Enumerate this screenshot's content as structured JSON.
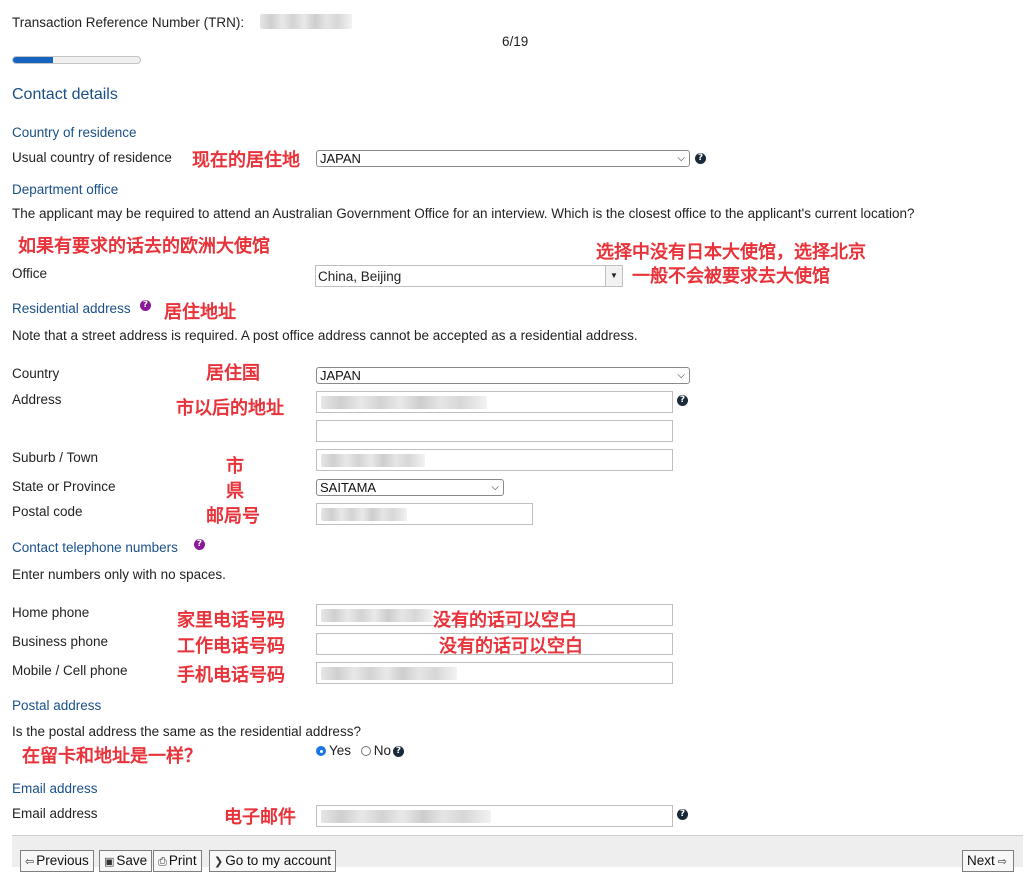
{
  "header": {
    "trn_label": "Transaction Reference Number (TRN):",
    "page_counter": "6/19",
    "progress_fraction": 0.3158
  },
  "contact_details": {
    "title": "Contact details"
  },
  "country_of_residence": {
    "section": "Country of residence",
    "label": "Usual country of residence",
    "value": "JAPAN",
    "annotation": "现在的居住地"
  },
  "department_office": {
    "section": "Department office",
    "description": "The applicant may be required to attend an Australian Government Office for an interview. Which is the closest office to the applicant's current location?",
    "annotation_1": "如果有要求的话去的欧洲大使馆",
    "annotation_2_line1": "选择中没有日本大使馆，选择北京",
    "annotation_2_line2": "一般不会被要求去大使馆",
    "office_label": "Office",
    "office_value": "China, Beijing"
  },
  "residential_address": {
    "section": "Residential address",
    "annotation": "居住地址",
    "note": "Note that a street address is required. A post office address cannot be accepted as a residential address.",
    "country_label": "Country",
    "country_value": "JAPAN",
    "country_annotation": "居住国",
    "address_label": "Address",
    "address_annotation": "市以后的地址",
    "suburb_label": "Suburb / Town",
    "suburb_annotation": "市",
    "state_label": "State or Province",
    "state_value": "SAITAMA",
    "state_annotation": "県",
    "postal_label": "Postal code",
    "postal_annotation": "邮局号"
  },
  "contact_phone": {
    "section": "Contact telephone numbers",
    "note": "Enter numbers only with no spaces.",
    "home_label": "Home phone",
    "home_annotation": "家里电话号码",
    "home_optional": "没有的话可以空白",
    "business_label": "Business phone",
    "business_annotation": "工作电话号码",
    "business_optional": "没有的话可以空白",
    "mobile_label": "Mobile / Cell phone",
    "mobile_annotation": "手机电话号码"
  },
  "postal_address": {
    "section": "Postal address",
    "question": "Is the postal address the same as the residential address?",
    "annotation": "在留卡和地址是一样？",
    "yes_label": "Yes",
    "no_label": "No"
  },
  "email": {
    "section": "Email address",
    "label": "Email address",
    "annotation": "电子邮件"
  },
  "footer": {
    "previous": "Previous",
    "save": "Save",
    "print": "Print",
    "account": "Go to my account",
    "next": "Next"
  },
  "icons": {
    "help": "question-mark-icon",
    "previous": "arrow-left-icon",
    "save": "floppy-disk-icon",
    "print": "printer-icon",
    "account": "chevron-right-icon",
    "next": "arrow-right-icon"
  },
  "colors": {
    "heading": "#1a4f8a",
    "annotation": "#e8333a",
    "progress": "#1565c0"
  }
}
